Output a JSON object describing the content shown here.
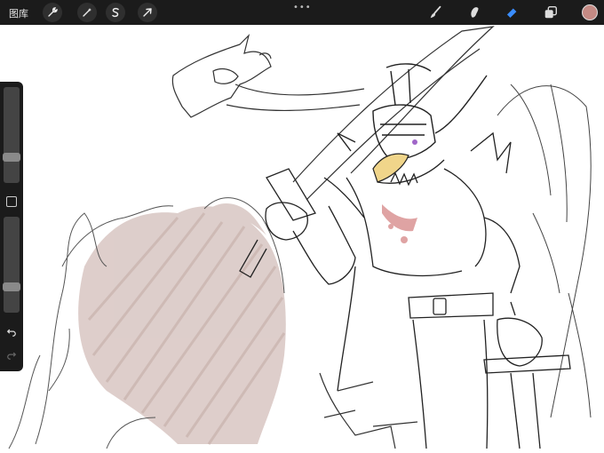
{
  "topbar": {
    "gallery_label": "图库",
    "left_tools": [
      {
        "name": "actions",
        "icon": "wrench-icon"
      },
      {
        "name": "adjustments",
        "icon": "magic-wand-icon"
      },
      {
        "name": "selection",
        "icon": "selection-s-icon"
      },
      {
        "name": "transform",
        "icon": "arrow-cursor-icon"
      }
    ],
    "more_label": "•••",
    "right_tools": [
      {
        "name": "brush",
        "icon": "brush-icon"
      },
      {
        "name": "smudge",
        "icon": "smudge-icon"
      },
      {
        "name": "eraser",
        "icon": "eraser-icon",
        "active": true
      },
      {
        "name": "layers",
        "icon": "layers-icon"
      }
    ],
    "current_color": "#c48a84",
    "active_tool_color": "#3a8dff"
  },
  "sidebar": {
    "brush_size_level": 0.25,
    "opacity_level": 0.25,
    "icons": [
      "modify-square-icon",
      "undo-icon",
      "redo-icon"
    ]
  },
  "colors": {
    "bar_bg": "#1b1b1b",
    "ink": "#2a2a2a",
    "flame_fill": "#d8c6c2",
    "accent_yellow": "#f0d58a",
    "accent_red": "#c04a4a",
    "accent_purple": "#a066c8"
  }
}
